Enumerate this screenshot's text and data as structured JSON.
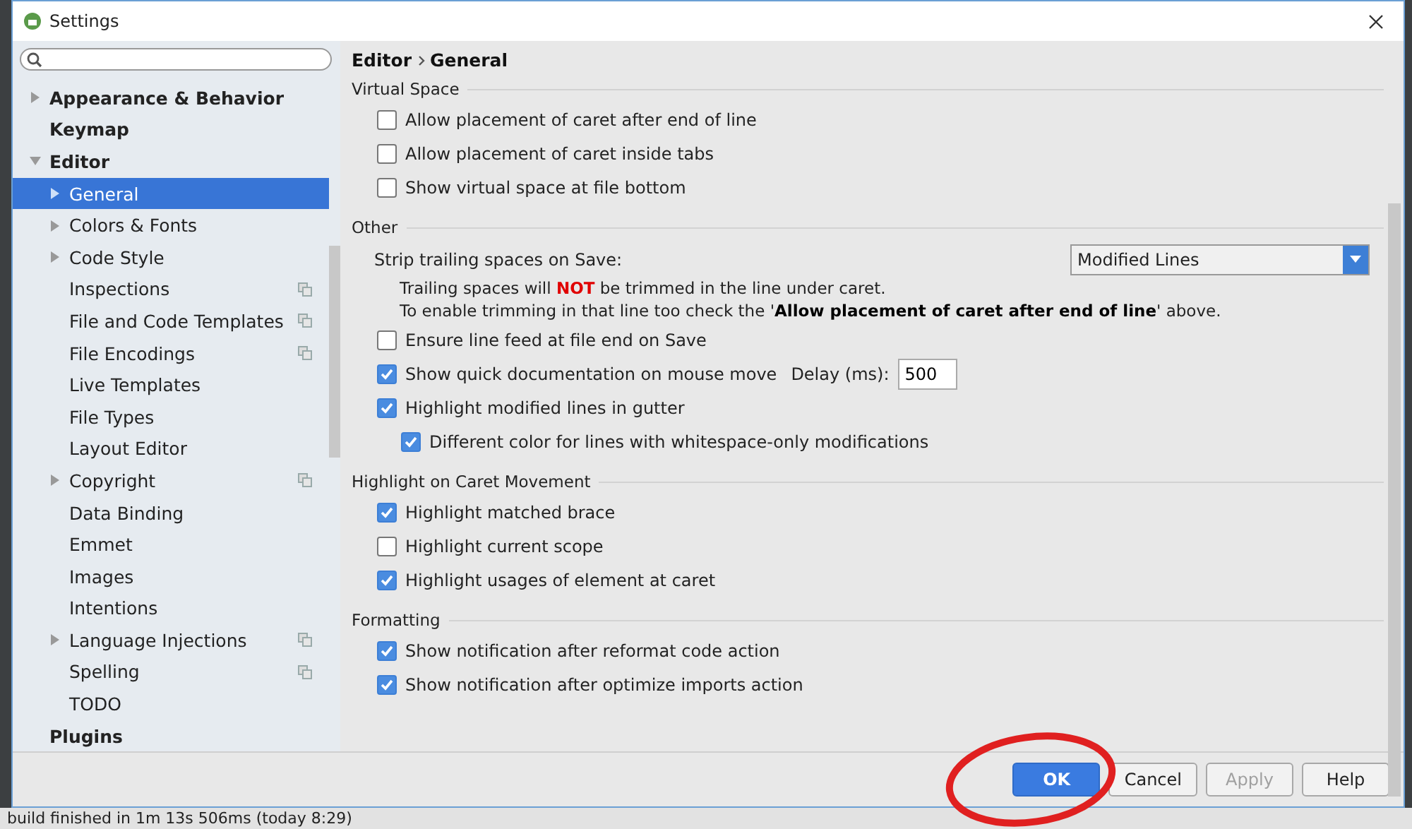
{
  "window": {
    "title": "Settings"
  },
  "sidebar": {
    "items": [
      {
        "label": "Appearance & Behavior",
        "expanded": false
      },
      {
        "label": "Keymap"
      },
      {
        "label": "Editor",
        "expanded": true,
        "children": [
          {
            "label": "General",
            "expanded": false,
            "selected": true,
            "project_scoped": false
          },
          {
            "label": "Colors & Fonts",
            "expanded": false,
            "selected": false,
            "project_scoped": false
          },
          {
            "label": "Code Style",
            "expanded": false,
            "selected": false,
            "project_scoped": false
          },
          {
            "label": "Inspections",
            "selected": false,
            "project_scoped": true
          },
          {
            "label": "File and Code Templates",
            "selected": false,
            "project_scoped": true
          },
          {
            "label": "File Encodings",
            "selected": false,
            "project_scoped": true
          },
          {
            "label": "Live Templates",
            "selected": false,
            "project_scoped": false
          },
          {
            "label": "File Types",
            "selected": false,
            "project_scoped": false
          },
          {
            "label": "Layout Editor",
            "selected": false,
            "project_scoped": false
          },
          {
            "label": "Copyright",
            "expanded": false,
            "selected": false,
            "project_scoped": true
          },
          {
            "label": "Data Binding",
            "selected": false,
            "project_scoped": false
          },
          {
            "label": "Emmet",
            "selected": false,
            "project_scoped": false
          },
          {
            "label": "Images",
            "selected": false,
            "project_scoped": false
          },
          {
            "label": "Intentions",
            "selected": false,
            "project_scoped": false
          },
          {
            "label": "Language Injections",
            "expanded": false,
            "selected": false,
            "project_scoped": true
          },
          {
            "label": "Spelling",
            "selected": false,
            "project_scoped": true
          },
          {
            "label": "TODO",
            "selected": false,
            "project_scoped": false
          }
        ]
      },
      {
        "label": "Plugins"
      }
    ]
  },
  "breadcrumb": [
    "Editor",
    "General"
  ],
  "sections": [
    {
      "title": "Virtual Space",
      "items": [
        {
          "kind": "checkbox",
          "label": "Allow placement of caret after end of line",
          "checked": false
        },
        {
          "kind": "checkbox",
          "label": "Allow placement of caret inside tabs",
          "checked": false
        },
        {
          "kind": "checkbox",
          "label": "Show virtual space at file bottom",
          "checked": false
        }
      ]
    },
    {
      "title": "Other",
      "items": [
        {
          "kind": "select",
          "label": "Strip trailing spaces on Save:",
          "value": "Modified Lines"
        },
        {
          "kind": "note",
          "alert": true,
          "text": "Trailing spaces will **NOT** be trimmed in the line under caret."
        },
        {
          "kind": "note",
          "alert": false,
          "text": "To enable trimming in that line too check the '**Allow placement of caret after end of line**' above."
        },
        {
          "kind": "checkbox",
          "label": "Ensure line feed at file end on Save",
          "checked": false
        },
        {
          "kind": "checkbox",
          "label": "Show quick documentation on mouse move",
          "checked": true,
          "field": {
            "label": "Delay (ms):",
            "value": "500"
          }
        },
        {
          "kind": "checkbox",
          "label": "Highlight modified lines in gutter",
          "checked": true,
          "children": [
            {
              "kind": "checkbox",
              "label": "Different color for lines with whitespace-only modifications",
              "checked": true
            }
          ]
        }
      ]
    },
    {
      "title": "Highlight on Caret Movement",
      "items": [
        {
          "kind": "checkbox",
          "label": "Highlight matched brace",
          "checked": true
        },
        {
          "kind": "checkbox",
          "label": "Highlight current scope",
          "checked": false
        },
        {
          "kind": "checkbox",
          "label": "Highlight usages of element at caret",
          "checked": true
        }
      ]
    },
    {
      "title": "Formatting",
      "items": [
        {
          "kind": "checkbox",
          "label": "Show notification after reformat code action",
          "checked": true
        },
        {
          "kind": "checkbox",
          "label": "Show notification after optimize imports action",
          "checked": true
        }
      ]
    }
  ],
  "buttons": [
    {
      "label": "OK",
      "default": true,
      "disabled": false
    },
    {
      "label": "Cancel",
      "default": false,
      "disabled": false
    },
    {
      "label": "Apply",
      "default": false,
      "disabled": true
    },
    {
      "label": "Help",
      "default": false,
      "disabled": false
    }
  ],
  "status_bar": {
    "text": "build finished in 1m 13s 506ms (today 8:29)"
  }
}
